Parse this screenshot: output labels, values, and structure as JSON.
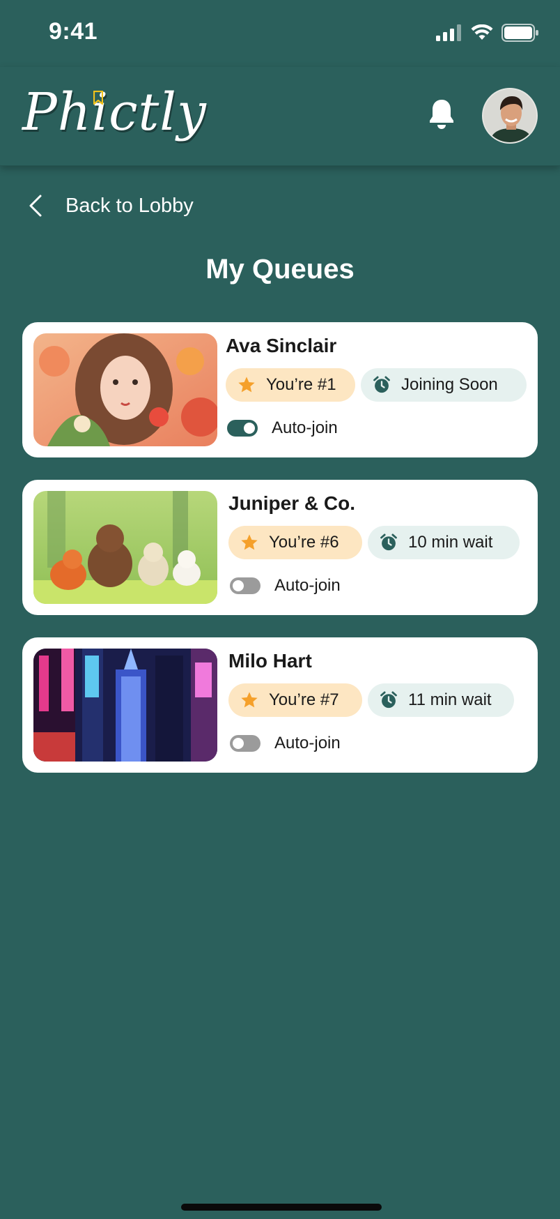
{
  "status_bar": {
    "time": "9:41"
  },
  "header": {
    "logo_text": "Phictly"
  },
  "nav": {
    "back_label": "Back to Lobby"
  },
  "page": {
    "title": "My Queues"
  },
  "queues": [
    {
      "name": "Ava Sinclair",
      "rank": "You’re #1",
      "wait": "Joining Soon",
      "auto_join_label": "Auto-join",
      "auto_join": true
    },
    {
      "name": "Juniper & Co.",
      "rank": "You’re #6",
      "wait": "10 min wait",
      "auto_join_label": "Auto-join",
      "auto_join": false
    },
    {
      "name": "Milo Hart",
      "rank": "You’re #7",
      "wait": "11 min wait",
      "auto_join_label": "Auto-join",
      "auto_join": false
    }
  ],
  "icons": {
    "rank": "star-icon",
    "wait": "alarm-clock-icon",
    "back": "chevron-left-icon",
    "notifications": "bell-icon"
  },
  "colors": {
    "background": "#2b605c",
    "card": "#ffffff",
    "rank_pill": "#fde6c2",
    "wait_pill": "#e6f1ef",
    "star": "#f5a02a",
    "toggle_on": "#2b605c",
    "toggle_off": "#9b9b9b"
  }
}
